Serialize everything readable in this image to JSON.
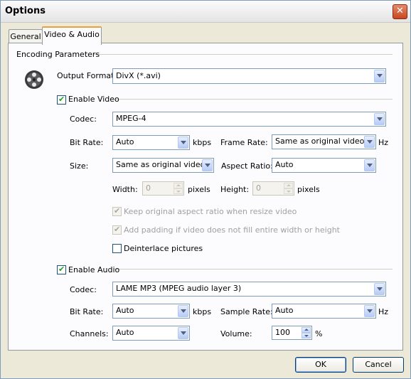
{
  "window": {
    "title": "Options",
    "close": "✕"
  },
  "tabs": {
    "general": "General",
    "video_audio": "Video & Audio"
  },
  "encoding": {
    "group_label": "Encoding Parameters",
    "output_format_label": "Output Format:",
    "output_format_value": "DivX (*.avi)"
  },
  "video": {
    "enable_label": "Enable Video",
    "enabled": true,
    "codec_label": "Codec:",
    "codec_value": "MPEG-4",
    "bitrate_label": "Bit Rate:",
    "bitrate_value": "Auto",
    "bitrate_unit": "kbps",
    "framerate_label": "Frame Rate:",
    "framerate_value": "Same as original video",
    "framerate_unit": "Hz",
    "size_label": "Size:",
    "size_value": "Same as original video",
    "aspect_label": "Aspect Ratio:",
    "aspect_value": "Auto",
    "width_label": "Width:",
    "width_value": "0",
    "width_unit": "pixels",
    "height_label": "Height:",
    "height_value": "0",
    "height_unit": "pixels",
    "keep_aspect_label": "Keep original aspect ratio when resize video",
    "add_padding_label": "Add padding if video does not fill entire width or height",
    "deinterlace_label": "Deinterlace pictures"
  },
  "audio": {
    "enable_label": "Enable Audio",
    "enabled": true,
    "codec_label": "Codec:",
    "codec_value": "LAME MP3 (MPEG audio layer 3)",
    "bitrate_label": "Bit Rate:",
    "bitrate_value": "Auto",
    "bitrate_unit": "kbps",
    "samplerate_label": "Sample Rate:",
    "samplerate_value": "Auto",
    "samplerate_unit": "Hz",
    "channels_label": "Channels:",
    "channels_value": "Auto",
    "volume_label": "Volume:",
    "volume_value": "100",
    "volume_unit": "%"
  },
  "buttons": {
    "ok": "OK",
    "cancel": "Cancel"
  }
}
